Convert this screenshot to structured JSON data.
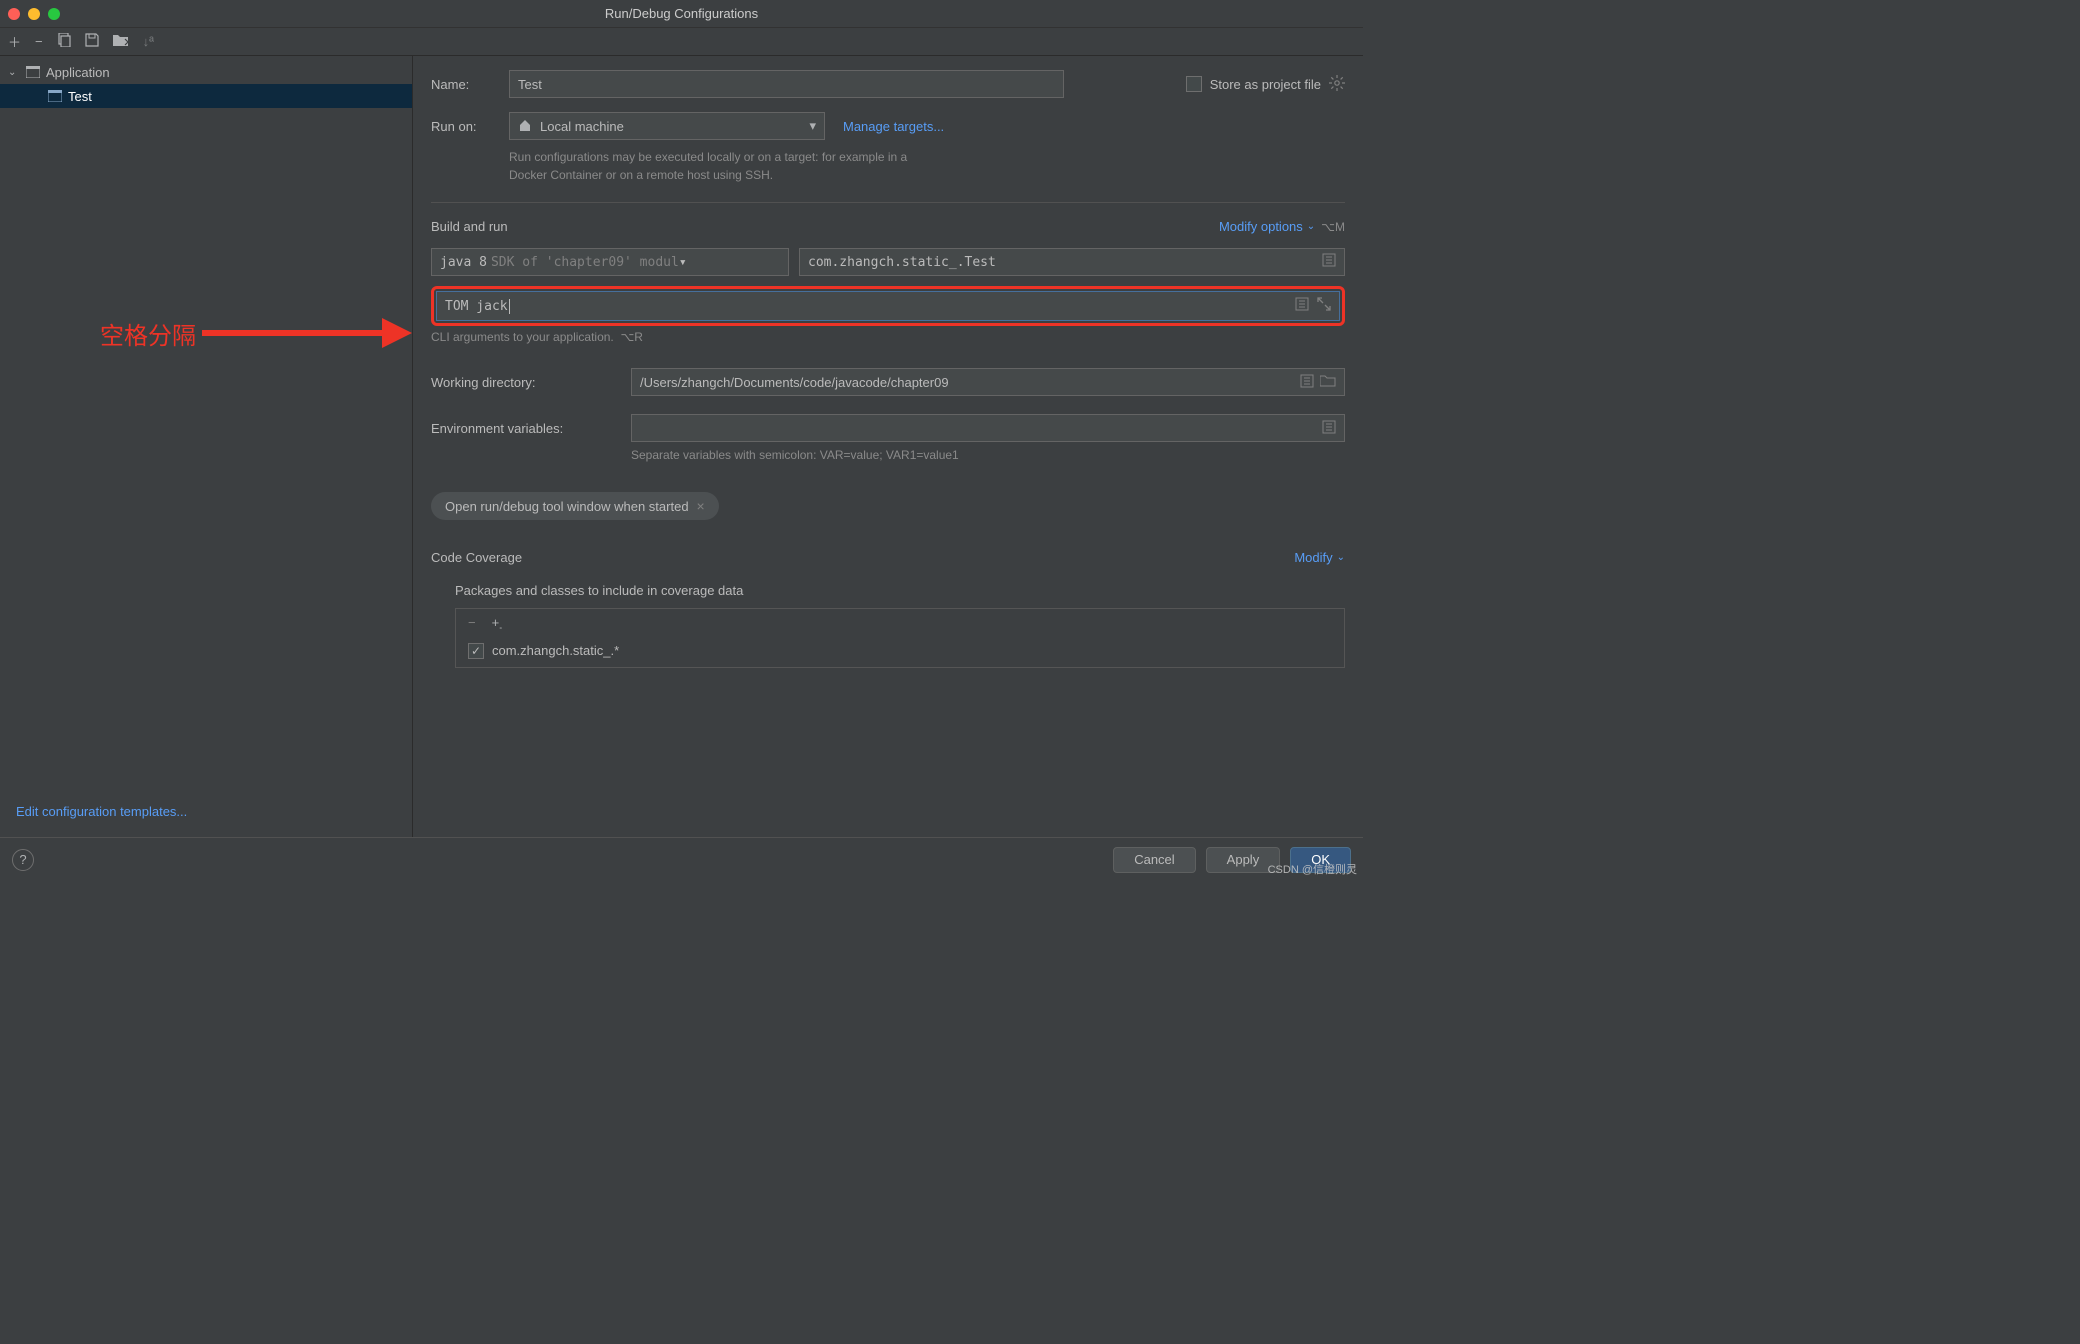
{
  "window": {
    "title": "Run/Debug Configurations"
  },
  "sidebar": {
    "root": "Application",
    "items": [
      "Test"
    ],
    "edit_templates": "Edit configuration templates..."
  },
  "form": {
    "name_label": "Name:",
    "name_value": "Test",
    "store_label": "Store as project file",
    "run_on_label": "Run on:",
    "run_on_value": "Local machine",
    "manage_targets": "Manage targets...",
    "run_hint": "Run configurations may be executed locally or on a target: for example in a Docker Container or on a remote host using SSH."
  },
  "build_run": {
    "title": "Build and run",
    "modify_options": "Modify options",
    "modify_shortcut": "⌥M",
    "sdk_main": "java 8",
    "sdk_sub": "SDK of 'chapter09' modul",
    "main_class": "com.zhangch.static_.Test",
    "args_value": "TOM jack",
    "args_hint": "CLI arguments to your application.",
    "args_shortcut": "⌥R"
  },
  "wd": {
    "label": "Working directory:",
    "value": "/Users/zhangch/Documents/code/javacode/chapter09"
  },
  "env": {
    "label": "Environment variables:",
    "hint": "Separate variables with semicolon: VAR=value; VAR1=value1"
  },
  "pill": {
    "text": "Open run/debug tool window when started"
  },
  "coverage": {
    "title": "Code Coverage",
    "modify": "Modify",
    "sub": "Packages and classes to include in coverage data",
    "item": "com.zhangch.static_.*"
  },
  "annotation": {
    "text": "空格分隔"
  },
  "buttons": {
    "cancel": "Cancel",
    "apply": "Apply",
    "ok": "OK"
  },
  "watermark": "CSDN @信橙则灵"
}
